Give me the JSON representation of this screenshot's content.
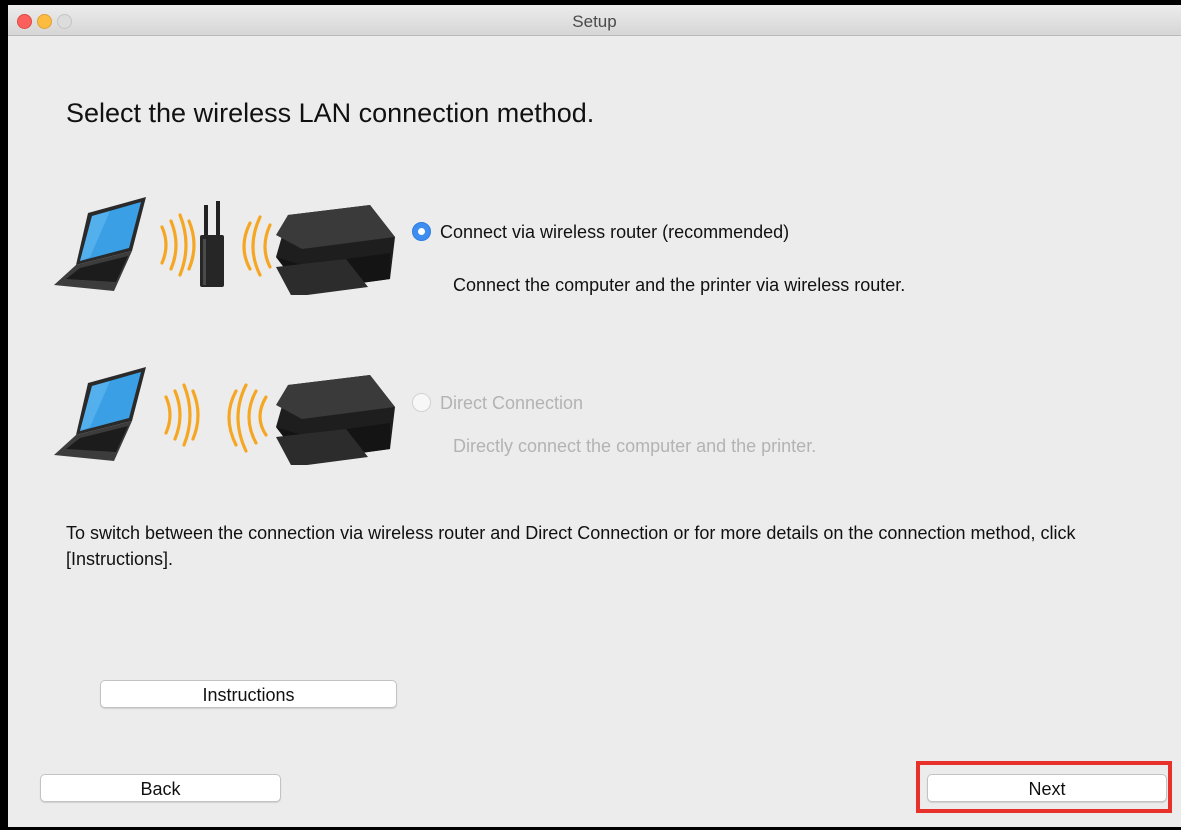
{
  "window": {
    "title": "Setup"
  },
  "heading": "Select the wireless LAN connection method.",
  "options": [
    {
      "label": "Connect via wireless router (recommended)",
      "description": "Connect the computer and the printer via wireless router.",
      "selected": true,
      "enabled": true
    },
    {
      "label": "Direct Connection",
      "description": "Directly connect the computer and the printer.",
      "selected": false,
      "enabled": false
    }
  ],
  "note": "To switch between the connection via wireless router and Direct Connection or for more details on the connection method, click [Instructions].",
  "buttons": {
    "instructions": "Instructions",
    "back": "Back",
    "next": "Next"
  },
  "colors": {
    "radio_selected": "#3d8ef0",
    "highlight": "#e8312a",
    "signal": "#f5a623"
  },
  "icons": [
    "laptop-icon",
    "wifi-waves-icon",
    "router-icon",
    "printer-icon"
  ]
}
